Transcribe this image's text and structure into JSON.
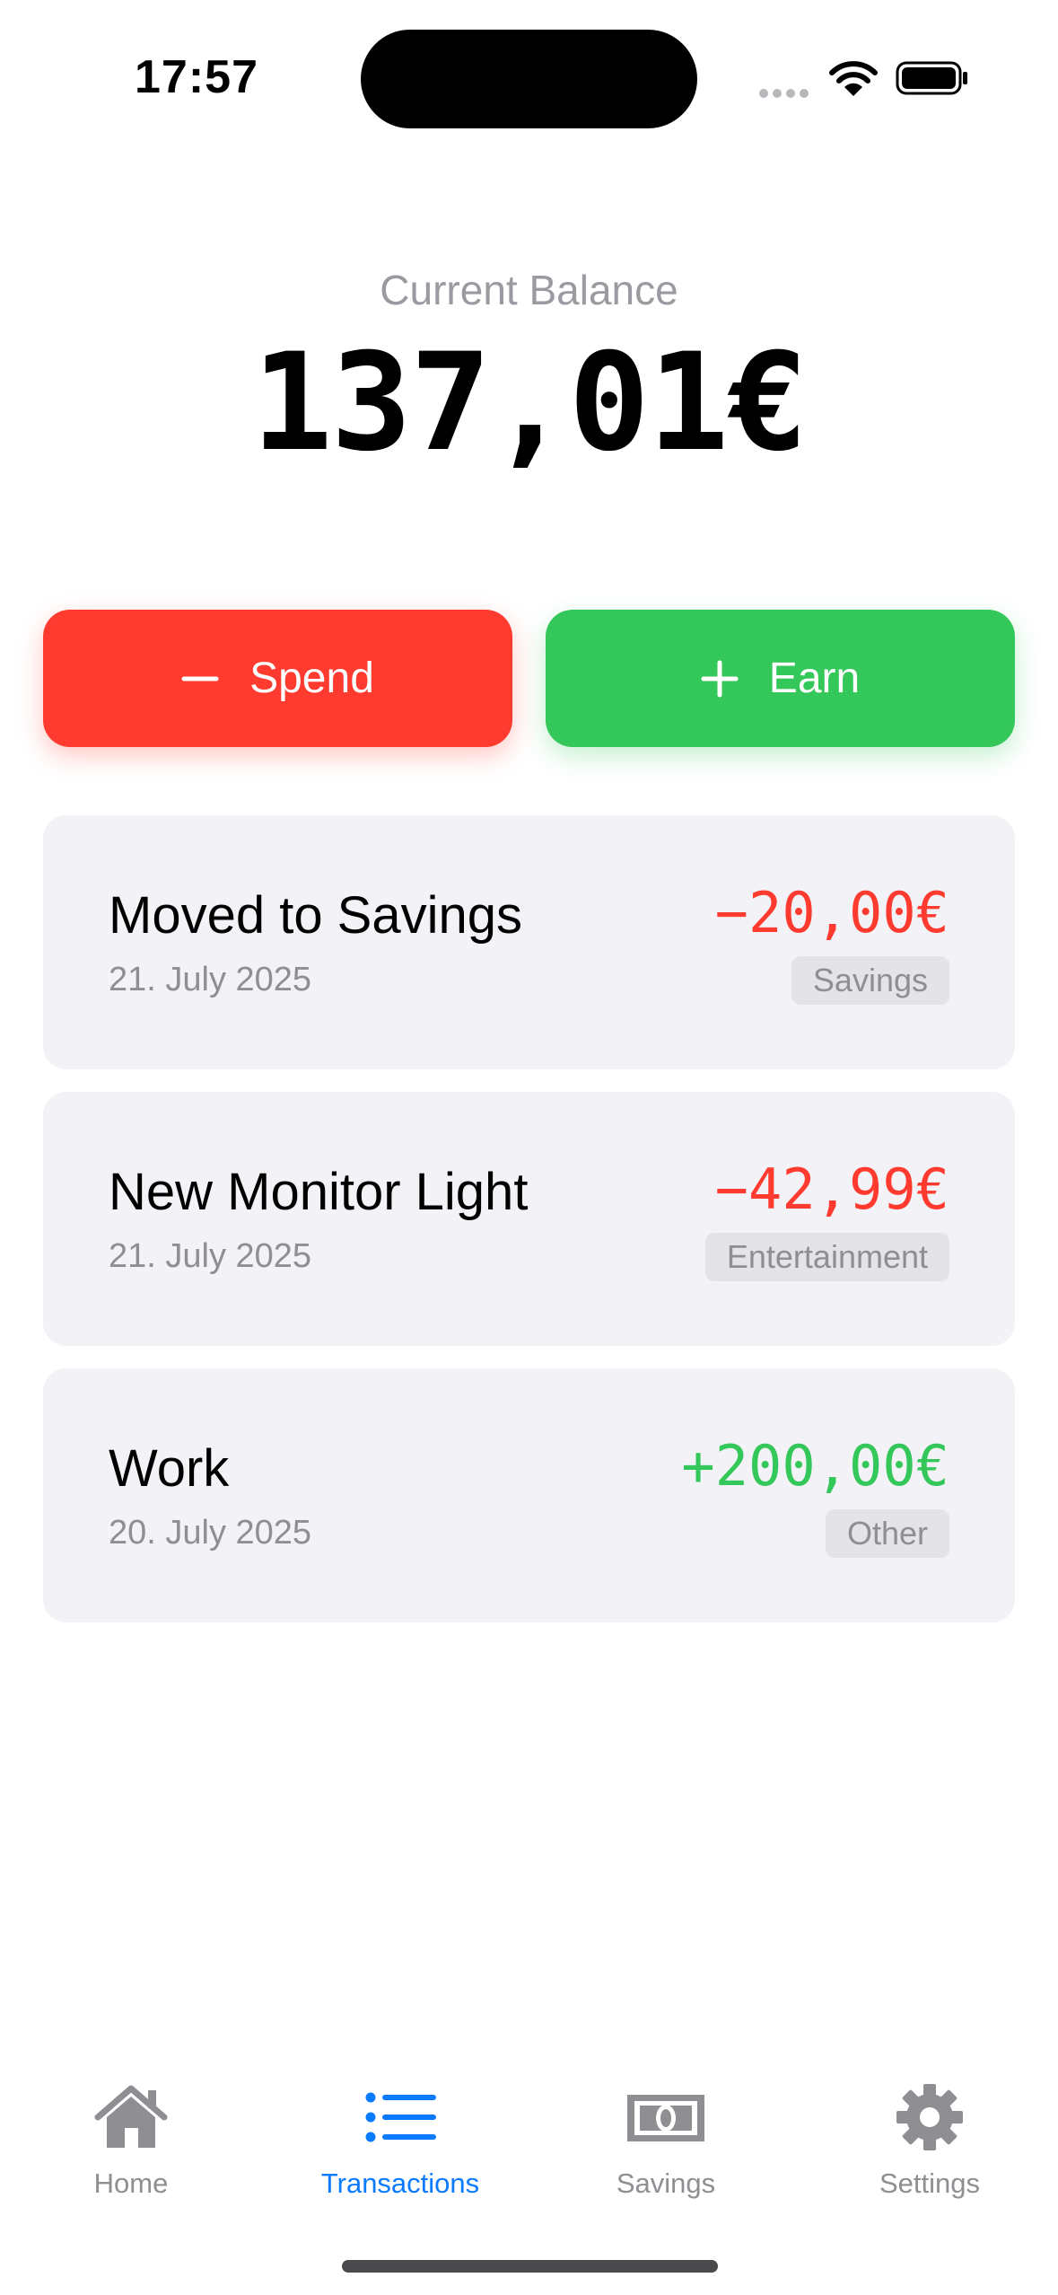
{
  "status_bar": {
    "time": "17:57"
  },
  "balance": {
    "label": "Current Balance",
    "value": "137,01€"
  },
  "actions": {
    "spend_label": "Spend",
    "earn_label": "Earn"
  },
  "transactions": [
    {
      "title": "Moved to Savings",
      "date": "21. July 2025",
      "amount": "−20,00€",
      "category": "Savings",
      "kind": "negative"
    },
    {
      "title": "New Monitor Light",
      "date": "21. July 2025",
      "amount": "−42,99€",
      "category": "Entertainment",
      "kind": "negative"
    },
    {
      "title": "Work",
      "date": "20. July 2025",
      "amount": "+200,00€",
      "category": "Other",
      "kind": "positive"
    }
  ],
  "tab_bar": {
    "items": [
      {
        "label": "Home",
        "icon": "house-icon",
        "active": false
      },
      {
        "label": "Transactions",
        "icon": "list-icon",
        "active": true
      },
      {
        "label": "Savings",
        "icon": "banknote-icon",
        "active": false
      },
      {
        "label": "Settings",
        "icon": "gear-icon",
        "active": false
      }
    ]
  },
  "colors": {
    "spend": "#ff3b30",
    "earn": "#34c759",
    "accent": "#0a7aff",
    "card_background": "#f2f2f7"
  }
}
